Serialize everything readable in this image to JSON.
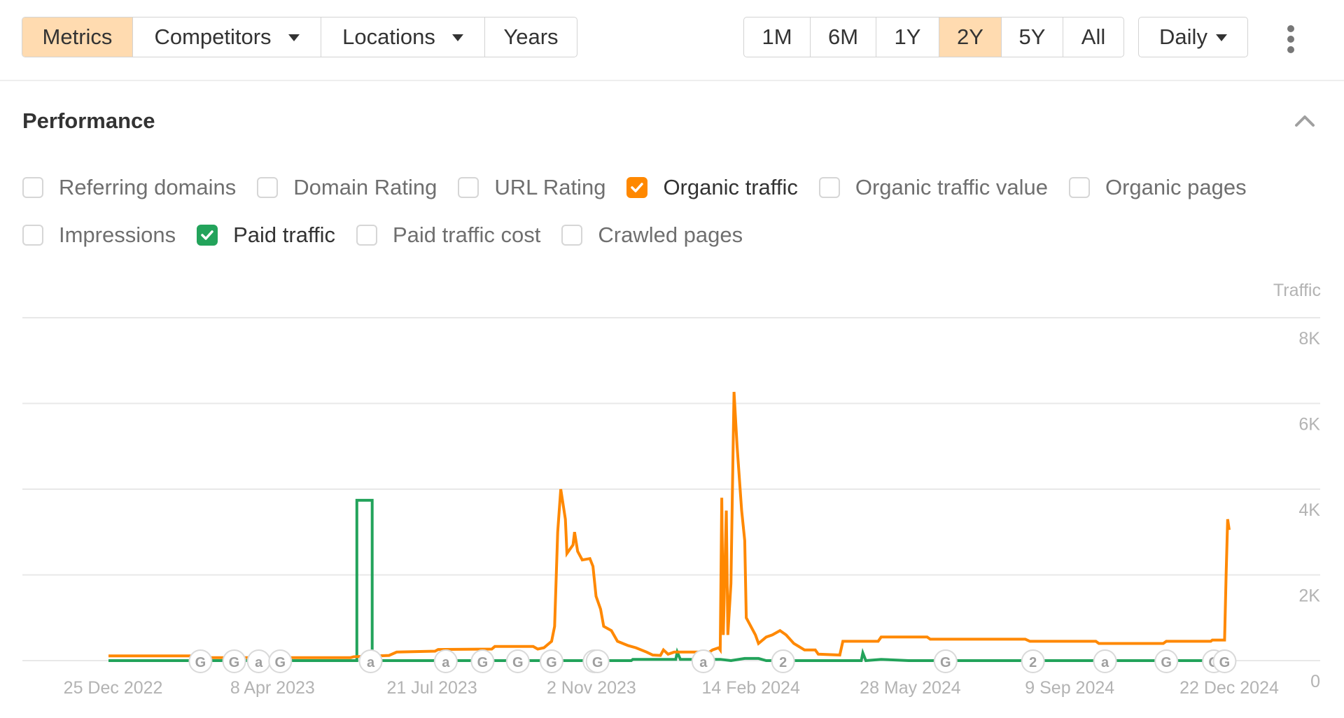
{
  "toolbar": {
    "left_buttons": [
      {
        "label": "Metrics",
        "active": true,
        "dropdown": false
      },
      {
        "label": "Competitors",
        "active": false,
        "dropdown": true
      },
      {
        "label": "Locations",
        "active": false,
        "dropdown": true
      },
      {
        "label": "Years",
        "active": false,
        "dropdown": false
      }
    ],
    "ranges": [
      {
        "label": "1M",
        "active": false
      },
      {
        "label": "6M",
        "active": false
      },
      {
        "label": "1Y",
        "active": false
      },
      {
        "label": "2Y",
        "active": true
      },
      {
        "label": "5Y",
        "active": false
      },
      {
        "label": "All",
        "active": false
      }
    ],
    "interval": "Daily",
    "more_icon": "vertical-ellipsis-icon"
  },
  "section": {
    "title": "Performance",
    "collapse_icon": "chevron-up-icon"
  },
  "metrics": {
    "row1": [
      {
        "label": "Referring domains",
        "checked": false
      },
      {
        "label": "Domain Rating",
        "checked": false
      },
      {
        "label": "URL Rating",
        "checked": false
      },
      {
        "label": "Organic traffic",
        "checked": true,
        "color": "#ff8800"
      },
      {
        "label": "Organic traffic value",
        "checked": false
      },
      {
        "label": "Organic pages",
        "checked": false
      }
    ],
    "row2": [
      {
        "label": "Impressions",
        "checked": false
      },
      {
        "label": "Paid traffic",
        "checked": true,
        "color": "#23a35b"
      },
      {
        "label": "Paid traffic cost",
        "checked": false
      },
      {
        "label": "Crawled pages",
        "checked": false
      }
    ]
  },
  "chart_data": {
    "type": "line",
    "title": "",
    "ylabel": "Traffic",
    "xlabel": "",
    "ylim": [
      0,
      8000
    ],
    "xlim": [
      "2022-12-22",
      "2024-12-22"
    ],
    "yticks": [
      {
        "value": 8000,
        "label": "8K"
      },
      {
        "value": 6000,
        "label": "6K"
      },
      {
        "value": 4000,
        "label": "4K"
      },
      {
        "value": 2000,
        "label": "2K"
      },
      {
        "value": 0,
        "label": "0"
      }
    ],
    "xticks": [
      {
        "date": "2022-12-25",
        "label": "25 Dec 2022"
      },
      {
        "date": "2023-04-08",
        "label": "8 Apr 2023"
      },
      {
        "date": "2023-07-21",
        "label": "21 Jul 2023"
      },
      {
        "date": "2023-11-02",
        "label": "2 Nov 2023"
      },
      {
        "date": "2024-02-14",
        "label": "14 Feb 2024"
      },
      {
        "date": "2024-05-28",
        "label": "28 May 2024"
      },
      {
        "date": "2024-09-09",
        "label": "9 Sep 2024"
      },
      {
        "date": "2024-12-22",
        "label": "22 Dec 2024"
      }
    ],
    "grid": true,
    "legend": "none",
    "series": [
      {
        "name": "Organic traffic",
        "color": "#ff8800",
        "points": [
          [
            "2022-12-22",
            110
          ],
          [
            "2023-02-22",
            110
          ],
          [
            "2023-02-26",
            70
          ],
          [
            "2023-05-29",
            70
          ],
          [
            "2023-05-31",
            90
          ],
          [
            "2023-06-23",
            120
          ],
          [
            "2023-06-28",
            200
          ],
          [
            "2023-07-23",
            220
          ],
          [
            "2023-07-25",
            260
          ],
          [
            "2023-08-29",
            270
          ],
          [
            "2023-08-31",
            330
          ],
          [
            "2023-09-25",
            330
          ],
          [
            "2023-09-28",
            270
          ],
          [
            "2023-10-02",
            300
          ],
          [
            "2023-10-07",
            450
          ],
          [
            "2023-10-09",
            800
          ],
          [
            "2023-10-11",
            3000
          ],
          [
            "2023-10-13",
            4000
          ],
          [
            "2023-10-16",
            3300
          ],
          [
            "2023-10-17",
            2500
          ],
          [
            "2023-10-21",
            2700
          ],
          [
            "2023-10-22",
            3000
          ],
          [
            "2023-10-24",
            2550
          ],
          [
            "2023-10-27",
            2350
          ],
          [
            "2023-11-01",
            2380
          ],
          [
            "2023-11-03",
            2200
          ],
          [
            "2023-11-05",
            1500
          ],
          [
            "2023-11-08",
            1200
          ],
          [
            "2023-11-10",
            800
          ],
          [
            "2023-11-15",
            700
          ],
          [
            "2023-11-19",
            450
          ],
          [
            "2023-11-26",
            350
          ],
          [
            "2023-12-01",
            300
          ],
          [
            "2023-12-08",
            200
          ],
          [
            "2023-12-12",
            130
          ],
          [
            "2023-12-17",
            120
          ],
          [
            "2023-12-19",
            250
          ],
          [
            "2023-12-22",
            150
          ],
          [
            "2023-12-26",
            200
          ],
          [
            "2024-01-13",
            200
          ],
          [
            "2024-01-16",
            150
          ],
          [
            "2024-01-20",
            250
          ],
          [
            "2024-01-24",
            300
          ],
          [
            "2024-01-25",
            250
          ],
          [
            "2024-01-26",
            3800
          ],
          [
            "2024-01-27",
            600
          ],
          [
            "2024-01-29",
            3500
          ],
          [
            "2024-01-30",
            600
          ],
          [
            "2024-02-01",
            1800
          ],
          [
            "2024-02-03",
            6270
          ],
          [
            "2024-02-05",
            5000
          ],
          [
            "2024-02-08",
            3500
          ],
          [
            "2024-02-10",
            2800
          ],
          [
            "2024-02-11",
            1000
          ],
          [
            "2024-02-17",
            600
          ],
          [
            "2024-02-19",
            400
          ],
          [
            "2024-02-24",
            550
          ],
          [
            "2024-02-28",
            600
          ],
          [
            "2024-03-04",
            700
          ],
          [
            "2024-03-08",
            600
          ],
          [
            "2024-03-13",
            400
          ],
          [
            "2024-03-20",
            250
          ],
          [
            "2024-03-27",
            250
          ],
          [
            "2024-03-29",
            150
          ],
          [
            "2024-04-12",
            130
          ],
          [
            "2024-04-14",
            450
          ],
          [
            "2024-05-07",
            450
          ],
          [
            "2024-05-09",
            550
          ],
          [
            "2024-06-08",
            550
          ],
          [
            "2024-06-10",
            500
          ],
          [
            "2024-08-11",
            500
          ],
          [
            "2024-08-14",
            450
          ],
          [
            "2024-09-26",
            450
          ],
          [
            "2024-09-28",
            400
          ],
          [
            "2024-11-09",
            400
          ],
          [
            "2024-11-11",
            450
          ],
          [
            "2024-12-10",
            450
          ],
          [
            "2024-12-11",
            480
          ],
          [
            "2024-12-19",
            480
          ],
          [
            "2024-12-20",
            2000
          ],
          [
            "2024-12-21",
            3300
          ],
          [
            "2024-12-22",
            3050
          ]
        ]
      },
      {
        "name": "Paid traffic",
        "color": "#23a35b",
        "points": [
          [
            "2022-12-22",
            0
          ],
          [
            "2023-06-02",
            0
          ],
          [
            "2023-06-02",
            3740
          ],
          [
            "2023-06-12",
            3740
          ],
          [
            "2023-06-12",
            0
          ],
          [
            "2023-11-28",
            0
          ],
          [
            "2023-11-29",
            30
          ],
          [
            "2023-12-27",
            30
          ],
          [
            "2023-12-28",
            200
          ],
          [
            "2023-12-30",
            30
          ],
          [
            "2024-01-25",
            30
          ],
          [
            "2024-02-01",
            0
          ],
          [
            "2024-02-10",
            50
          ],
          [
            "2024-02-19",
            50
          ],
          [
            "2024-02-24",
            0
          ],
          [
            "2024-04-26",
            0
          ],
          [
            "2024-04-27",
            180
          ],
          [
            "2024-04-29",
            0
          ],
          [
            "2024-05-09",
            30
          ],
          [
            "2024-05-27",
            0
          ],
          [
            "2024-12-22",
            0
          ]
        ]
      }
    ],
    "annotations": [
      {
        "date": "2023-02-20",
        "icon": "G"
      },
      {
        "date": "2023-03-14",
        "icon": "G"
      },
      {
        "date": "2023-03-30",
        "icon": "a"
      },
      {
        "date": "2023-04-13",
        "icon": "G"
      },
      {
        "date": "2023-06-11",
        "icon": "a"
      },
      {
        "date": "2023-07-30",
        "icon": "a"
      },
      {
        "date": "2023-08-23",
        "icon": "G"
      },
      {
        "date": "2023-09-15",
        "icon": "G"
      },
      {
        "date": "2023-10-07",
        "icon": "G"
      },
      {
        "date": "2023-11-04",
        "icon": "G"
      },
      {
        "date": "2023-11-06",
        "icon": "G"
      },
      {
        "date": "2024-01-14",
        "icon": "a"
      },
      {
        "date": "2024-03-06",
        "icon": "2"
      },
      {
        "date": "2024-06-20",
        "icon": "G"
      },
      {
        "date": "2024-08-16",
        "icon": "2"
      },
      {
        "date": "2024-10-02",
        "icon": "a"
      },
      {
        "date": "2024-11-11",
        "icon": "G"
      },
      {
        "date": "2024-12-12",
        "icon": "G"
      },
      {
        "date": "2024-12-19",
        "icon": "G"
      }
    ]
  }
}
